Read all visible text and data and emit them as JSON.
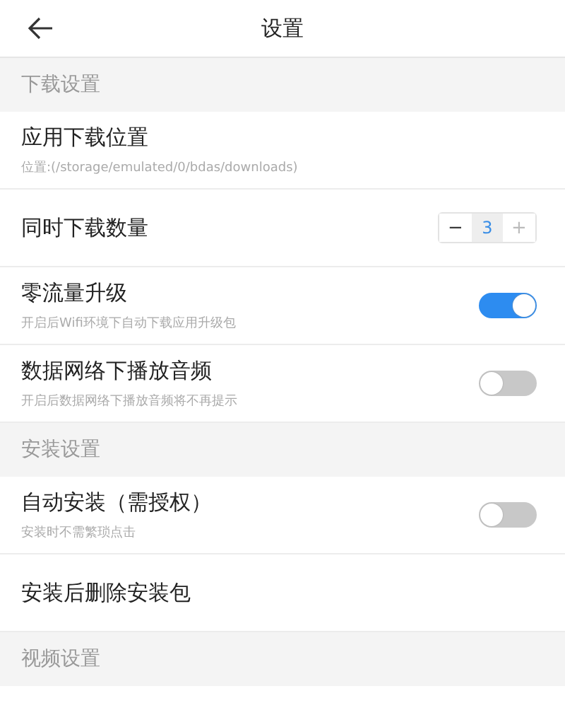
{
  "header": {
    "title": "设置"
  },
  "sections": [
    {
      "title": "下载设置",
      "items": [
        {
          "kind": "plain",
          "label": "应用下载位置",
          "subtitle": "位置:(/storage/emulated/0/bdas/downloads)"
        },
        {
          "kind": "stepper",
          "label": "同时下载数量",
          "minus": "−",
          "value": "3",
          "plus": "+"
        },
        {
          "kind": "toggle",
          "label": "零流量升级",
          "subtitle": "开启后Wifi环境下自动下载应用升级包",
          "on": true
        },
        {
          "kind": "toggle",
          "label": "数据网络下播放音频",
          "subtitle": "开启后数据网络下播放音频将不再提示",
          "on": false
        }
      ]
    },
    {
      "title": "安装设置",
      "items": [
        {
          "kind": "toggle",
          "label": "自动安装（需授权）",
          "subtitle": "安装时不需繁琐点击",
          "on": false
        },
        {
          "kind": "plain",
          "label": "安装后删除安装包"
        }
      ]
    },
    {
      "title": "视频设置"
    }
  ]
}
